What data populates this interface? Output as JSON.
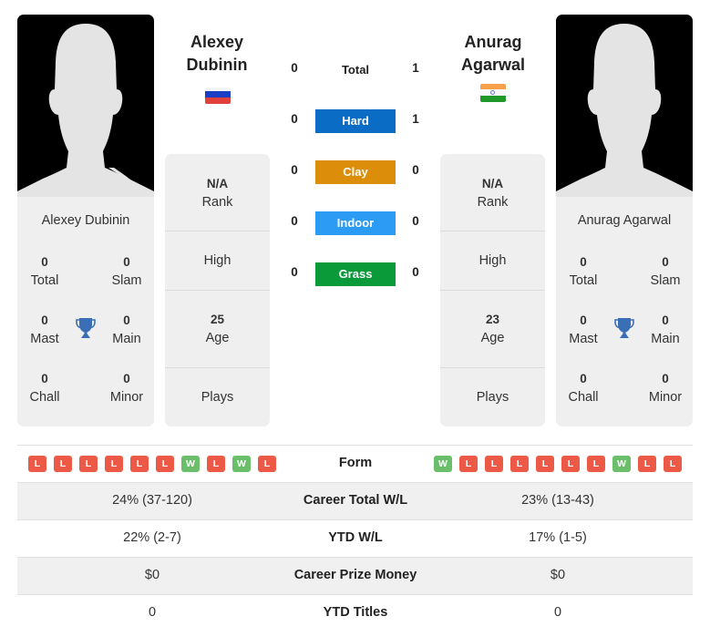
{
  "players": {
    "left": {
      "name_line1": "Alexey",
      "name_line2": "Dubinin",
      "full_name": "Alexey Dubinin",
      "country_flag": "russia-flag",
      "titles": {
        "total": "0",
        "total_label": "Total",
        "slam": "0",
        "slam_label": "Slam",
        "mast": "0",
        "mast_label": "Mast",
        "main": "0",
        "main_label": "Main",
        "chall": "0",
        "chall_label": "Chall",
        "minor": "0",
        "minor_label": "Minor"
      },
      "info": {
        "rank_value": "N/A",
        "rank_label": "Rank",
        "high_label": "High",
        "age_value": "25",
        "age_label": "Age",
        "plays_label": "Plays"
      },
      "form": [
        "L",
        "L",
        "L",
        "L",
        "L",
        "L",
        "W",
        "L",
        "W",
        "L"
      ]
    },
    "right": {
      "name_line1": "Anurag",
      "name_line2": "Agarwal",
      "full_name": "Anurag Agarwal",
      "country_flag": "india-flag",
      "titles": {
        "total": "0",
        "total_label": "Total",
        "slam": "0",
        "slam_label": "Slam",
        "mast": "0",
        "mast_label": "Mast",
        "main": "0",
        "main_label": "Main",
        "chall": "0",
        "chall_label": "Chall",
        "minor": "0",
        "minor_label": "Minor"
      },
      "info": {
        "rank_value": "N/A",
        "rank_label": "Rank",
        "high_label": "High",
        "age_value": "23",
        "age_label": "Age",
        "plays_label": "Plays"
      },
      "form": [
        "W",
        "L",
        "L",
        "L",
        "L",
        "L",
        "L",
        "W",
        "L",
        "L"
      ]
    }
  },
  "h2h": {
    "total": {
      "label": "Total",
      "left": "0",
      "right": "1"
    },
    "surfaces": [
      {
        "label": "Hard",
        "left": "0",
        "right": "1",
        "color": "#0a6cc4"
      },
      {
        "label": "Clay",
        "left": "0",
        "right": "0",
        "color": "#dc8e0a"
      },
      {
        "label": "Indoor",
        "left": "0",
        "right": "0",
        "color": "#2b9bf4"
      },
      {
        "label": "Grass",
        "left": "0",
        "right": "0",
        "color": "#0b9a3a"
      }
    ]
  },
  "form_label": "Form",
  "stats": [
    {
      "label": "Career Total W/L",
      "left": "24% (37-120)",
      "right": "23% (13-43)"
    },
    {
      "label": "YTD W/L",
      "left": "22% (2-7)",
      "right": "17% (1-5)"
    },
    {
      "label": "Career Prize Money",
      "left": "$0",
      "right": "$0"
    },
    {
      "label": "YTD Titles",
      "left": "0",
      "right": "0"
    }
  ],
  "colors": {
    "win": "#6bbf6b",
    "loss": "#ec5a47",
    "trophy": "#3a6fb7"
  }
}
